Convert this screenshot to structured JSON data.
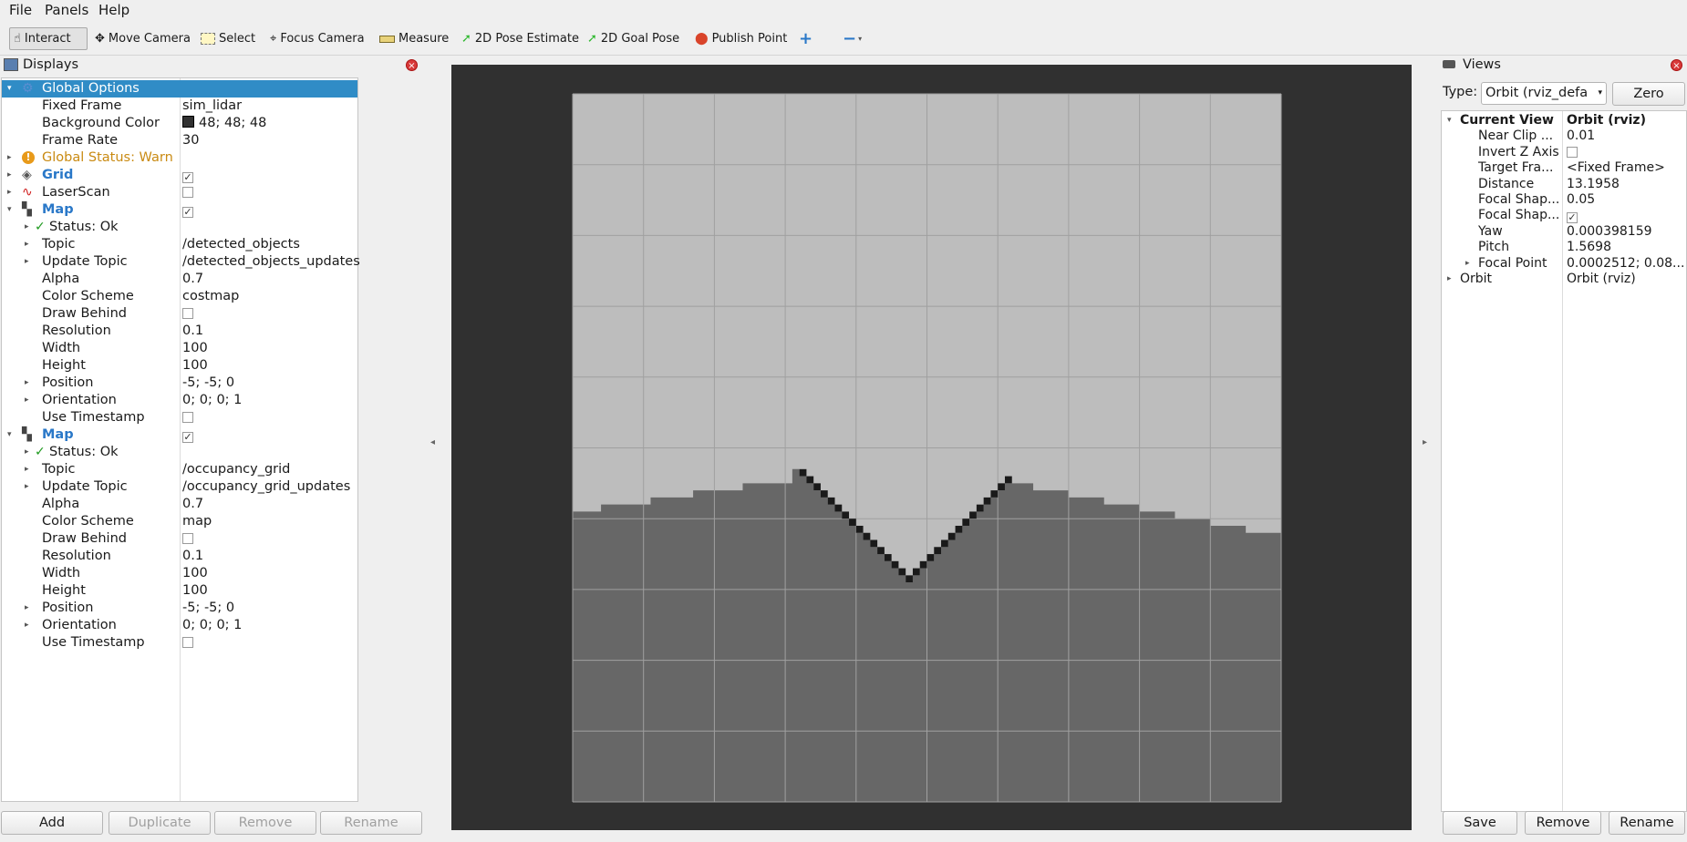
{
  "menu": [
    "File",
    "Panels",
    "Help"
  ],
  "toolbar": {
    "interact": "Interact",
    "move_camera": "Move Camera",
    "select": "Select",
    "focus_camera": "Focus Camera",
    "measure": "Measure",
    "pose_estimate": "2D Pose Estimate",
    "goal_pose": "2D Goal Pose",
    "publish_point": "Publish Point"
  },
  "displays": {
    "title": "Displays",
    "global_options": "Global Options",
    "fixed_frame_label": "Fixed Frame",
    "fixed_frame": "sim_lidar",
    "bg_color_label": "Background Color",
    "bg_color": "48; 48; 48",
    "frame_rate_label": "Frame Rate",
    "frame_rate": "30",
    "global_status": "Global Status: Warn",
    "grid": "Grid",
    "laserscan": "LaserScan",
    "map1": {
      "name": "Map",
      "status": "Status: Ok",
      "topic_label": "Topic",
      "topic": "/detected_objects",
      "update_topic_label": "Update Topic",
      "update_topic": "/detected_objects_updates",
      "alpha_label": "Alpha",
      "alpha": "0.7",
      "color_scheme_label": "Color Scheme",
      "color_scheme": "costmap",
      "draw_behind_label": "Draw Behind",
      "resolution_label": "Resolution",
      "resolution": "0.1",
      "width_label": "Width",
      "width": "100",
      "height_label": "Height",
      "height": "100",
      "position_label": "Position",
      "position": "-5; -5; 0",
      "orientation_label": "Orientation",
      "orientation": "0; 0; 0; 1",
      "use_timestamp_label": "Use Timestamp"
    },
    "map2": {
      "name": "Map",
      "status": "Status: Ok",
      "topic_label": "Topic",
      "topic": "/occupancy_grid",
      "update_topic_label": "Update Topic",
      "update_topic": "/occupancy_grid_updates",
      "alpha_label": "Alpha",
      "alpha": "0.7",
      "color_scheme_label": "Color Scheme",
      "color_scheme": "map",
      "draw_behind_label": "Draw Behind",
      "resolution_label": "Resolution",
      "resolution": "0.1",
      "width_label": "Width",
      "width": "100",
      "height_label": "Height",
      "height": "100",
      "position_label": "Position",
      "position": "-5; -5; 0",
      "orientation_label": "Orientation",
      "orientation": "0; 0; 0; 1",
      "use_timestamp_label": "Use Timestamp"
    },
    "buttons": {
      "add": "Add",
      "duplicate": "Duplicate",
      "remove": "Remove",
      "rename": "Rename"
    }
  },
  "views": {
    "title": "Views",
    "type_label": "Type:",
    "type_value": "Orbit (rviz_default_plugins)",
    "zero": "Zero",
    "current_view_label": "Current View",
    "current_view": "Orbit (rviz)",
    "near_clip_label": "Near Clip ...",
    "near_clip": "0.01",
    "invert_z_label": "Invert Z Axis",
    "target_frame_label": "Target Fra...",
    "target_frame": "<Fixed Frame>",
    "distance_label": "Distance",
    "distance": "13.1958",
    "focal_shape1_label": "Focal Shap...",
    "focal_shape1": "0.05",
    "focal_shape2_label": "Focal Shap...",
    "yaw_label": "Yaw",
    "yaw": "0.000398159",
    "pitch_label": "Pitch",
    "pitch": "1.5698",
    "focal_point_label": "Focal Point",
    "focal_point": "0.0002512; 0.08...",
    "orbit_label": "Orbit",
    "orbit": "Orbit (rviz)",
    "buttons": {
      "save": "Save",
      "remove": "Remove",
      "rename": "Rename"
    }
  },
  "colors": {
    "selection": "#308cc6",
    "viewport_bg": "#303030",
    "map_light": "#bdbdbd",
    "map_dark": "#676767",
    "obstacle": "#1a1a1a"
  }
}
